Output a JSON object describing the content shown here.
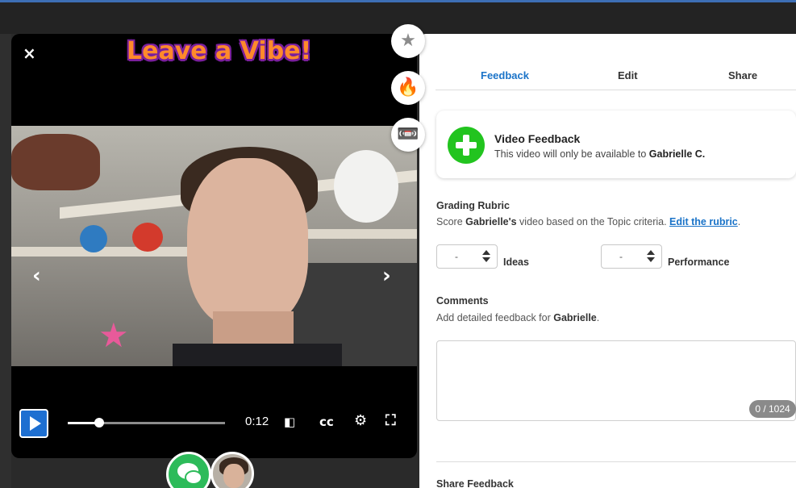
{
  "player": {
    "close_glyph": "×",
    "title": "Leave a Vibe!",
    "nav_prev_glyph": "‹",
    "nav_next_glyph": "›",
    "time": "0:12",
    "progress_fraction": 0.2,
    "cc_label": "cc",
    "audio_icon": "audio-description-icon",
    "settings_icon": "gear-icon",
    "fullscreen_icon": "fullscreen-icon"
  },
  "side_actions": [
    {
      "icon": "star-icon",
      "glyph": "★",
      "color": "#8c8c8c"
    },
    {
      "icon": "fire-icon",
      "glyph": "🔥",
      "color": "#f05a23"
    },
    {
      "icon": "cassette-icon",
      "glyph": "📼",
      "color": "#5a3a2a"
    }
  ],
  "tabs": {
    "feedback": "Feedback",
    "edit": "Edit",
    "share": "Share"
  },
  "video_feedback": {
    "title": "Video Feedback",
    "subtitle_prefix": "This video will only be available to ",
    "subtitle_name": "Gabrielle C."
  },
  "grading": {
    "title": "Grading Rubric",
    "sub_prefix": "Score ",
    "sub_name": "Gabrielle's",
    "sub_middle": " video based on the Topic criteria. ",
    "sub_link": "Edit the rubric",
    "sub_end": ".",
    "ideas_value": "-",
    "ideas_label": "Ideas",
    "performance_value": "-",
    "performance_label": "Performance"
  },
  "comments": {
    "title": "Comments",
    "sub_prefix": "Add detailed feedback for ",
    "sub_name": "Gabrielle",
    "sub_end": ".",
    "counter": "0 / 1024"
  },
  "share_feedback": {
    "title": "Share Feedback"
  },
  "colors": {
    "accent": "#1a73c8",
    "play": "#1d6fd1",
    "add_green": "#22c41f",
    "chat_green": "#2dbb5a",
    "vibe_orange": "#ff8a2b"
  }
}
